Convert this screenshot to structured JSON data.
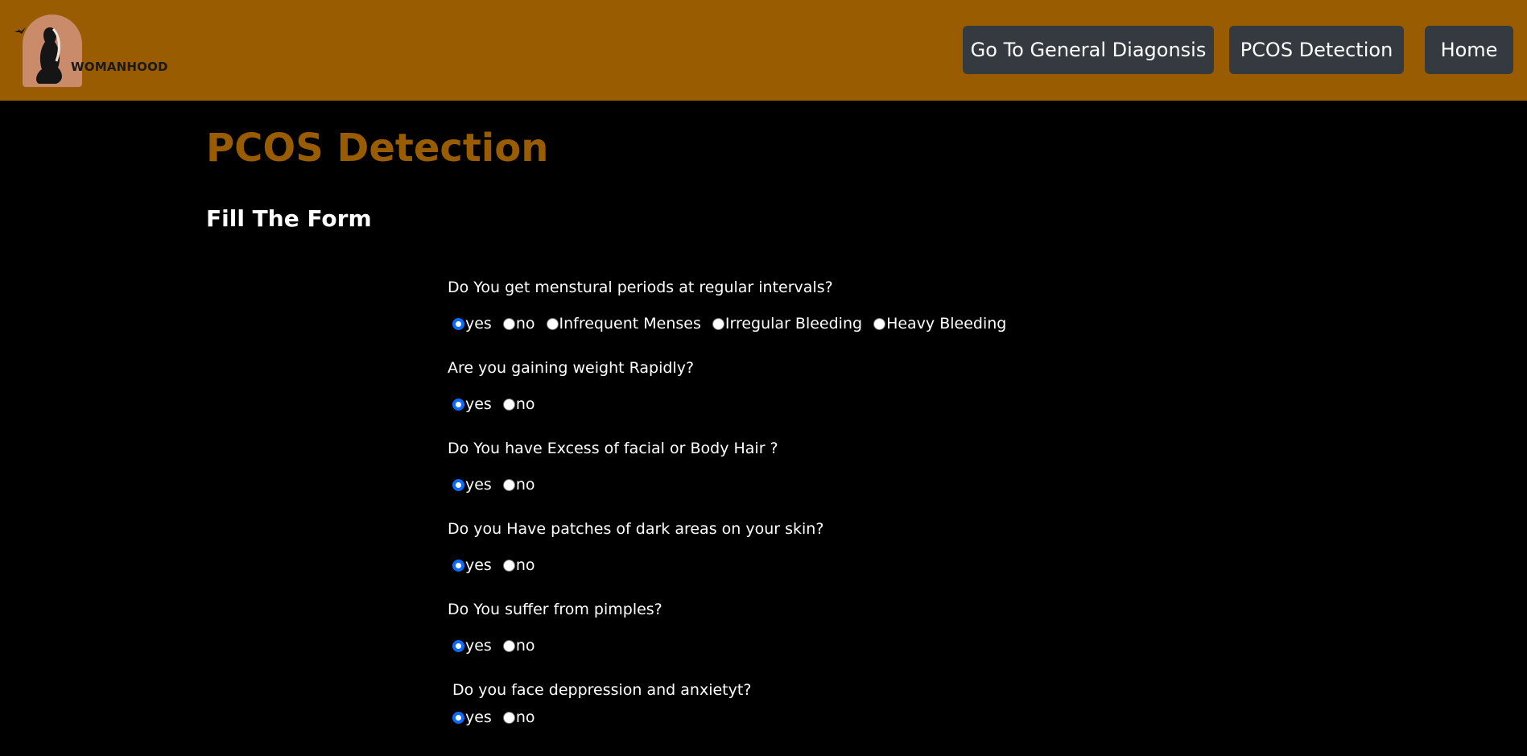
{
  "brand": {
    "name": "WOMANHOOD"
  },
  "nav": {
    "general_diagnosis": "Go To General Diagonsis",
    "pcos_detection": "PCOS Detection",
    "home": "Home"
  },
  "main": {
    "title": "PCOS Detection",
    "subtitle": "Fill The Form"
  },
  "colors": {
    "brand": "#9a5c00",
    "button": "#343a40",
    "radio_checked": "#0a6cff"
  },
  "questions": [
    {
      "text": "Do You get menstural periods at regular intervals?",
      "options": [
        "yes",
        "no",
        "Infrequent Menses",
        "Irregular Bleeding",
        "Heavy Bleeding"
      ],
      "selected": "yes"
    },
    {
      "text": "Are you gaining weight Rapidly?",
      "options": [
        "yes",
        "no"
      ],
      "selected": "yes"
    },
    {
      "text": "Do You have Excess of facial or Body Hair ?",
      "options": [
        "yes",
        "no"
      ],
      "selected": "yes"
    },
    {
      "text": "Do you Have patches of dark areas on your skin?",
      "options": [
        "yes",
        "no"
      ],
      "selected": "yes"
    },
    {
      "text": "Do You suffer from pimples?",
      "options": [
        "yes",
        "no"
      ],
      "selected": "yes"
    },
    {
      "text": "Do you face deppression and anxietyt?",
      "options": [
        "yes",
        "no"
      ],
      "selected": "yes"
    }
  ]
}
